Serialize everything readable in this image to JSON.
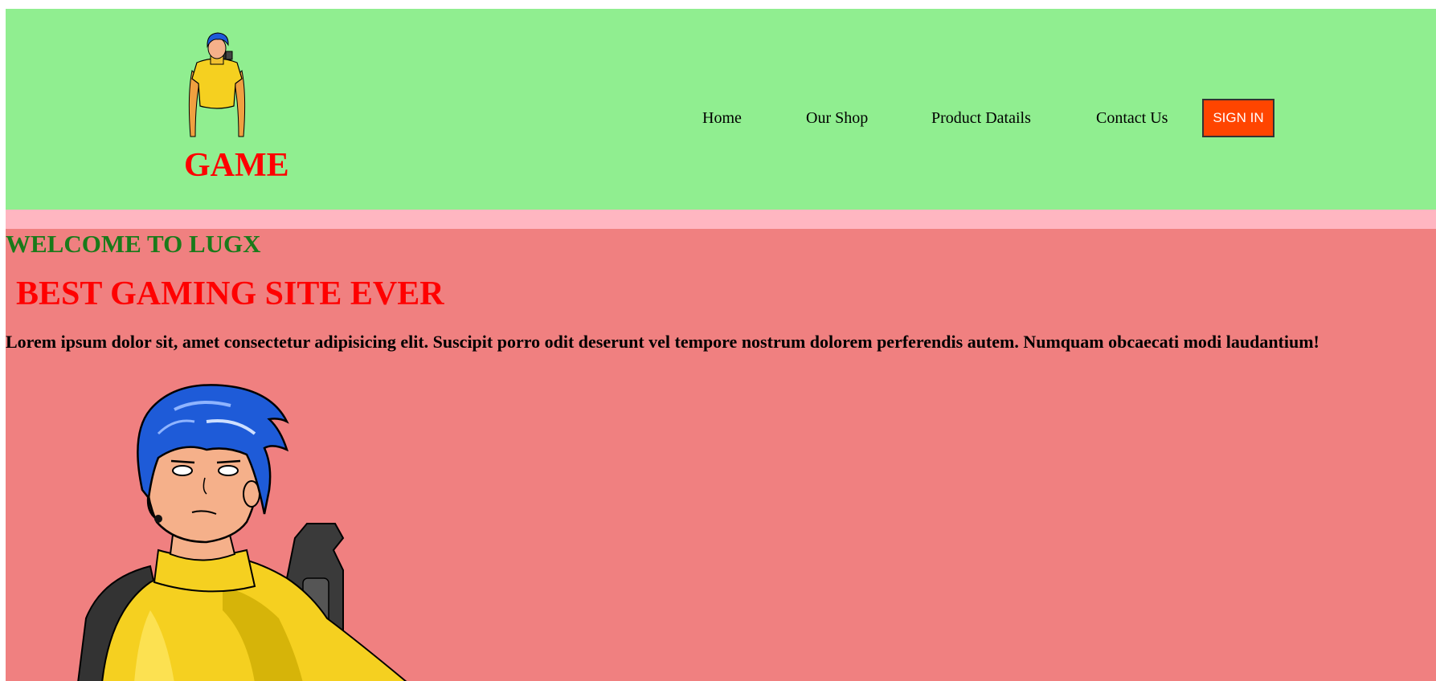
{
  "header": {
    "logo_text": "GAME",
    "logo_icon": "gamer-character-icon",
    "nav": {
      "home": "Home",
      "shop": "Our Shop",
      "product": "Product Datails",
      "contact": "Contact Us"
    },
    "signin_label": "SIGN IN"
  },
  "hero": {
    "welcome": "WELCOME TO LUGX",
    "tagline": "BEST GAMING SITE EVER",
    "body": "Lorem ipsum dolor sit, amet consectetur adipisicing elit. Suscipit porro odit deserunt vel tempore nostrum dolorem perferendis autem. Numquam obcaecati modi laudantium!",
    "illustration": "gamer-character-illustration"
  },
  "colors": {
    "header_bg": "#90ee90",
    "strip_bg": "#ffb6c1",
    "hero_bg": "#f08080",
    "logo_text": "#ff0000",
    "welcome_text": "#1a7a1a",
    "signin_bg": "#ff4500"
  }
}
